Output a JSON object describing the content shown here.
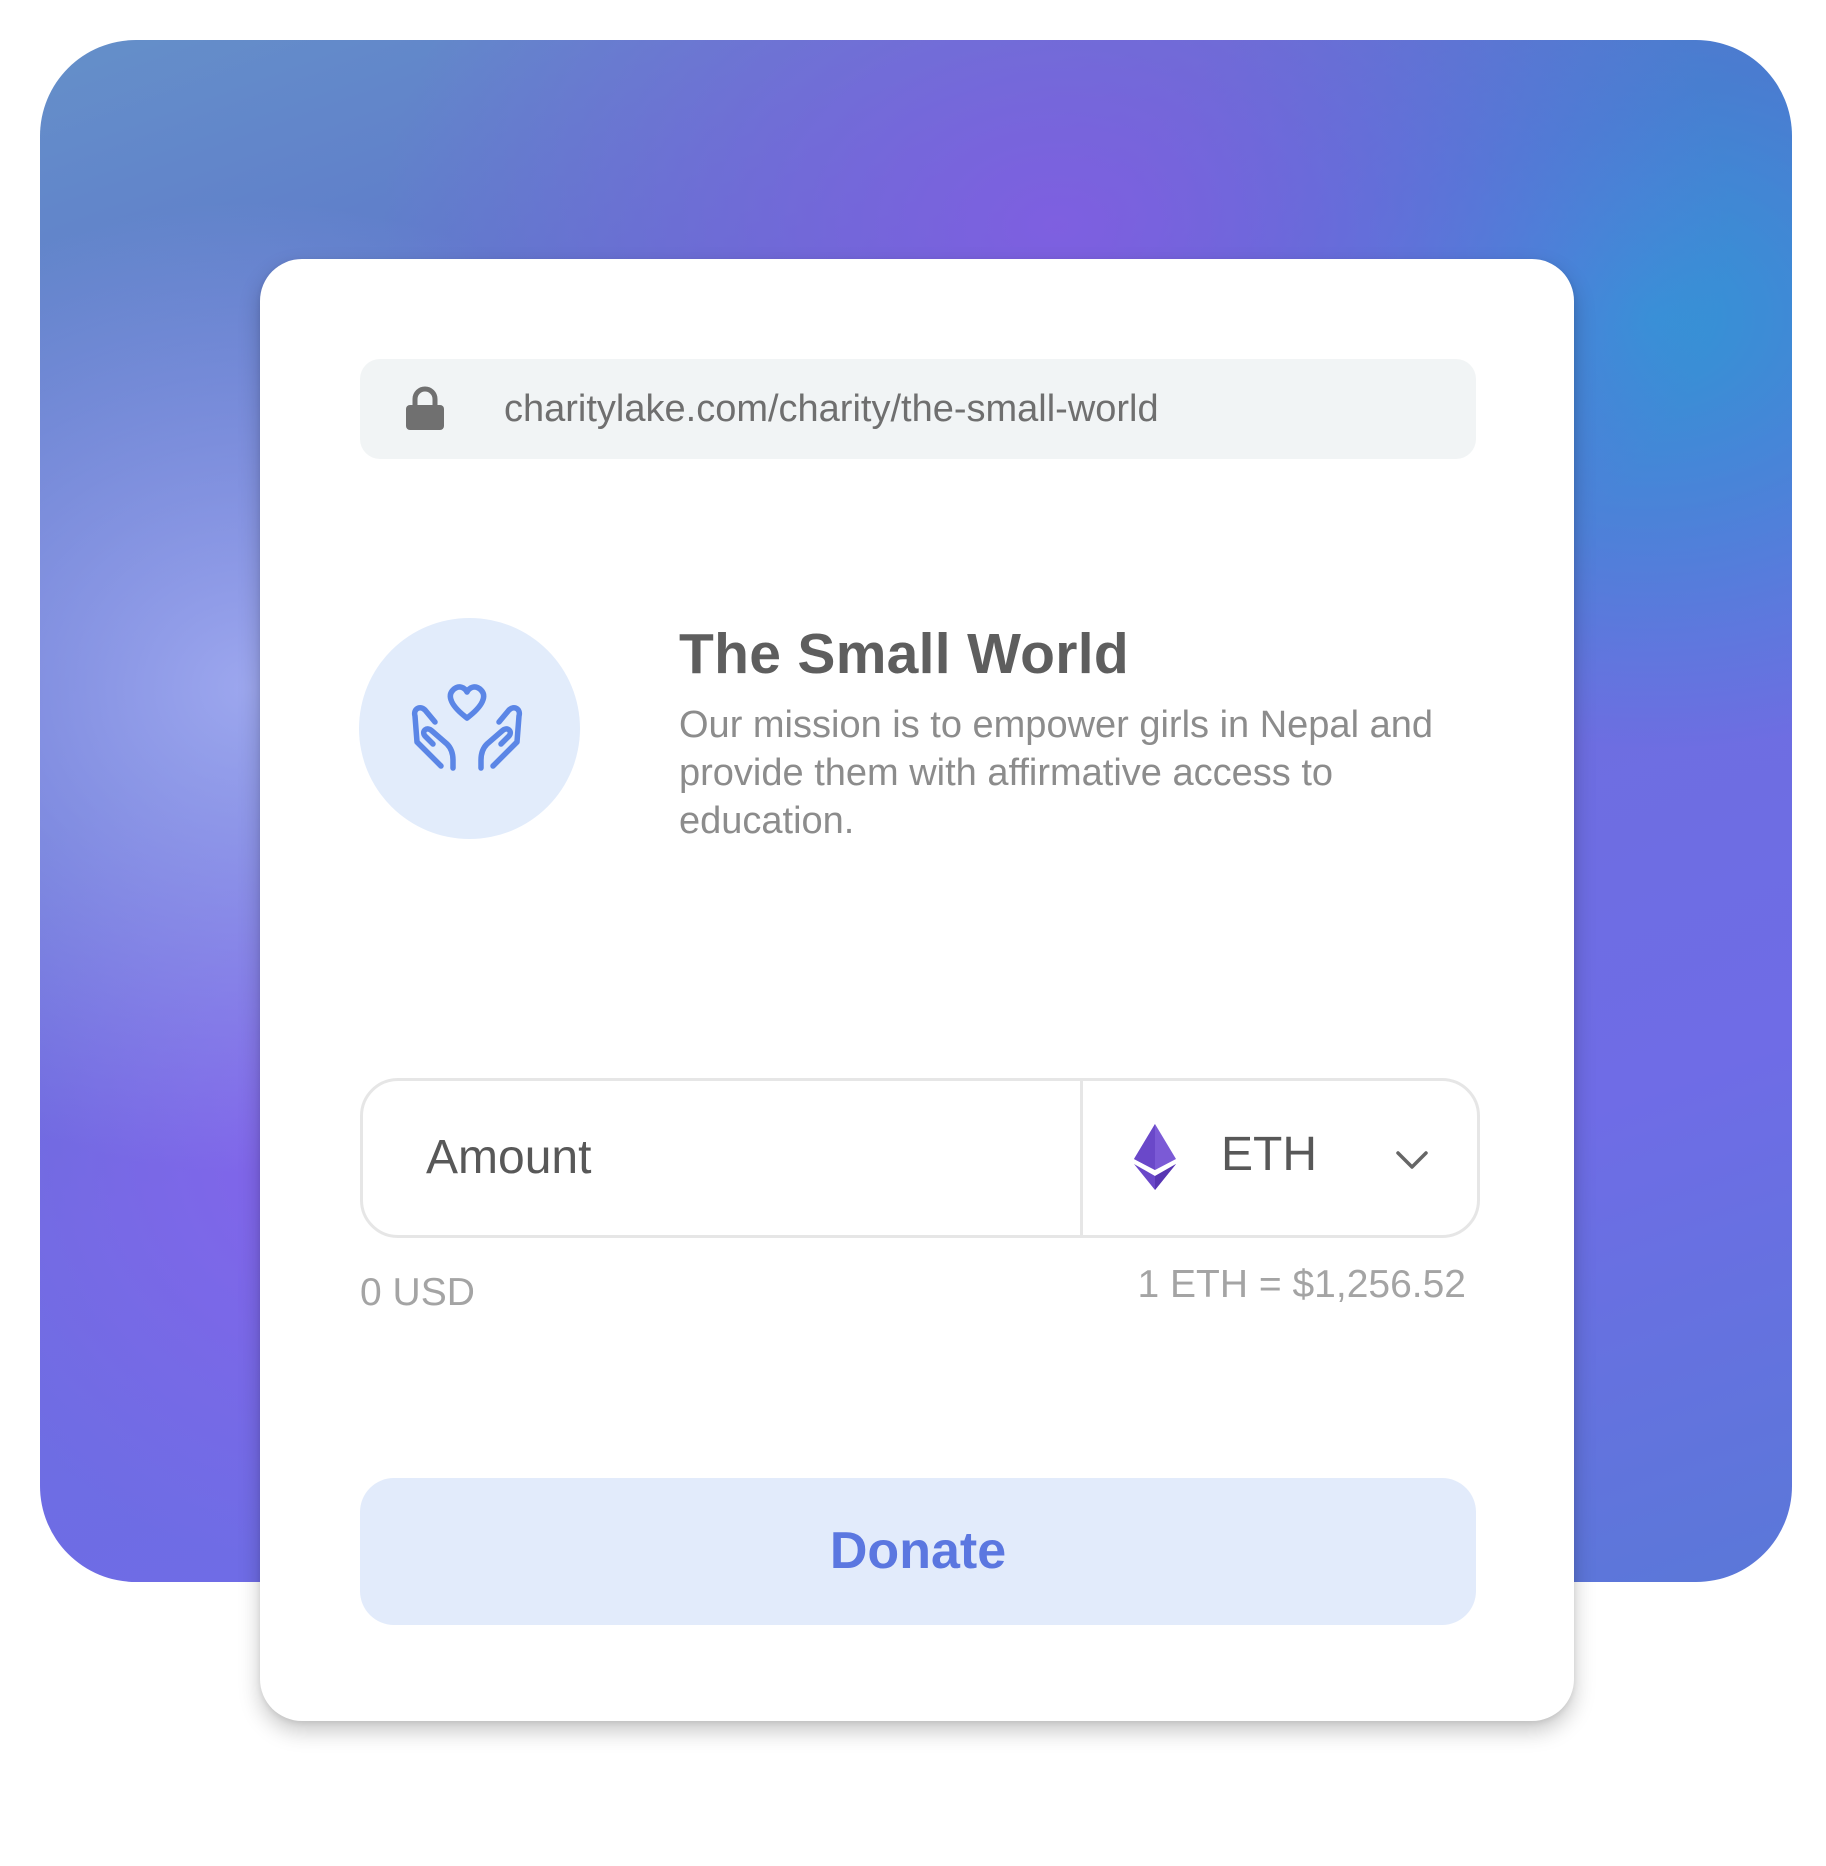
{
  "browser": {
    "url": "charitylake.com/charity/the-small-world"
  },
  "charity": {
    "name": "The Small World",
    "description": "Our mission is to empower girls in Nepal and provide them with affirmative access to education.",
    "logo_icon": "hands-heart-icon"
  },
  "donation_form": {
    "amount_placeholder": "Amount",
    "currency": "ETH",
    "currency_icon": "ethereum-icon",
    "usd_value": "0 USD",
    "exchange_rate": "1 ETH = $1,256.52",
    "donate_label": "Donate"
  },
  "colors": {
    "accent": "#5b77e0",
    "button_bg": "#e2ebfb",
    "avatar_bg": "#e2ecfb",
    "eth_purple": "#6a48c9",
    "url_bar_bg": "#f1f4f5"
  }
}
